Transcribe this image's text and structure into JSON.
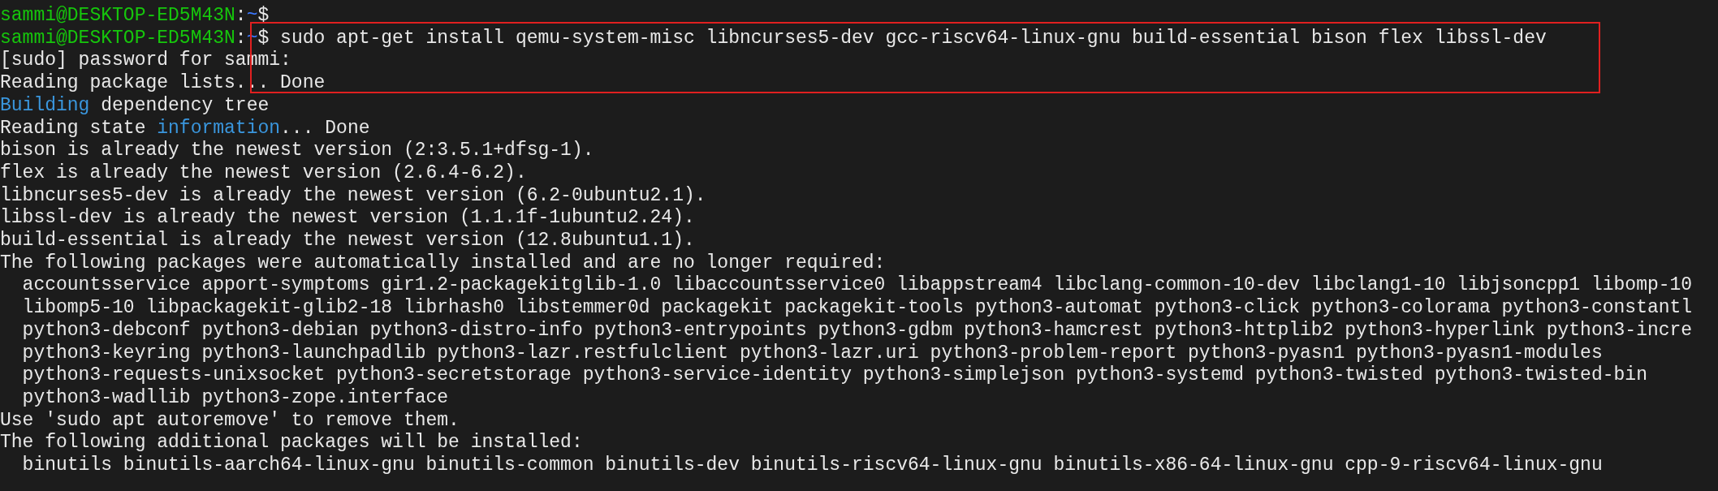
{
  "lines": [
    {
      "segments": [
        {
          "kind": "user",
          "text": "sammi@DESKTOP-ED5M43N"
        },
        {
          "kind": "plain",
          "text": ":"
        },
        {
          "kind": "path",
          "text": "~"
        },
        {
          "kind": "plain",
          "text": "$"
        }
      ]
    },
    {
      "segments": [
        {
          "kind": "user",
          "text": "sammi@DESKTOP-ED5M43N"
        },
        {
          "kind": "plain",
          "text": ":"
        },
        {
          "kind": "path",
          "text": "~"
        },
        {
          "kind": "plain",
          "text": "$ sudo apt-get install qemu-system-misc libncurses5-dev gcc-riscv64-linux-gnu build-essential bison flex libssl-dev"
        }
      ]
    },
    {
      "segments": [
        {
          "kind": "plain",
          "text": "[sudo] password for sammi:"
        }
      ]
    },
    {
      "segments": [
        {
          "kind": "plain",
          "text": "Reading package lists... Done"
        }
      ]
    },
    {
      "segments": [
        {
          "kind": "accent",
          "text": "Building"
        },
        {
          "kind": "plain",
          "text": " dependency tree"
        }
      ]
    },
    {
      "segments": [
        {
          "kind": "plain",
          "text": "Reading state "
        },
        {
          "kind": "accent",
          "text": "information"
        },
        {
          "kind": "plain",
          "text": "... Done"
        }
      ]
    },
    {
      "segments": [
        {
          "kind": "plain",
          "text": "bison is already the newest version (2:3.5.1+dfsg-1)."
        }
      ]
    },
    {
      "segments": [
        {
          "kind": "plain",
          "text": "flex is already the newest version (2.6.4-6.2)."
        }
      ]
    },
    {
      "segments": [
        {
          "kind": "plain",
          "text": "libncurses5-dev is already the newest version (6.2-0ubuntu2.1)."
        }
      ]
    },
    {
      "segments": [
        {
          "kind": "plain",
          "text": "libssl-dev is already the newest version (1.1.1f-1ubuntu2.24)."
        }
      ]
    },
    {
      "segments": [
        {
          "kind": "plain",
          "text": "build-essential is already the newest version (12.8ubuntu1.1)."
        }
      ]
    },
    {
      "segments": [
        {
          "kind": "plain",
          "text": "The following packages were automatically installed and are no longer required:"
        }
      ]
    },
    {
      "segments": [
        {
          "kind": "plain",
          "text": "  accountsservice apport-symptoms gir1.2-packagekitglib-1.0 libaccountsservice0 libappstream4 libclang-common-10-dev libclang1-10 libjsoncpp1 libomp-10"
        }
      ]
    },
    {
      "segments": [
        {
          "kind": "plain",
          "text": "  libomp5-10 libpackagekit-glib2-18 librhash0 libstemmer0d packagekit packagekit-tools python3-automat python3-click python3-colorama python3-constantl"
        }
      ]
    },
    {
      "segments": [
        {
          "kind": "plain",
          "text": "  python3-debconf python3-debian python3-distro-info python3-entrypoints python3-gdbm python3-hamcrest python3-httplib2 python3-hyperlink python3-incre"
        }
      ]
    },
    {
      "segments": [
        {
          "kind": "plain",
          "text": "  python3-keyring python3-launchpadlib python3-lazr.restfulclient python3-lazr.uri python3-problem-report python3-pyasn1 python3-pyasn1-modules"
        }
      ]
    },
    {
      "segments": [
        {
          "kind": "plain",
          "text": "  python3-requests-unixsocket python3-secretstorage python3-service-identity python3-simplejson python3-systemd python3-twisted python3-twisted-bin"
        }
      ]
    },
    {
      "segments": [
        {
          "kind": "plain",
          "text": "  python3-wadllib python3-zope.interface"
        }
      ]
    },
    {
      "segments": [
        {
          "kind": "plain",
          "text": "Use 'sudo apt autoremove' to remove them."
        }
      ]
    },
    {
      "segments": [
        {
          "kind": "plain",
          "text": "The following additional packages will be installed:"
        }
      ]
    },
    {
      "segments": [
        {
          "kind": "plain",
          "text": "  binutils binutils-aarch64-linux-gnu binutils-common binutils-dev binutils-riscv64-linux-gnu binutils-x86-64-linux-gnu cpp-9-riscv64-linux-gnu"
        }
      ]
    }
  ],
  "annotation": {
    "kind": "rectangle"
  }
}
